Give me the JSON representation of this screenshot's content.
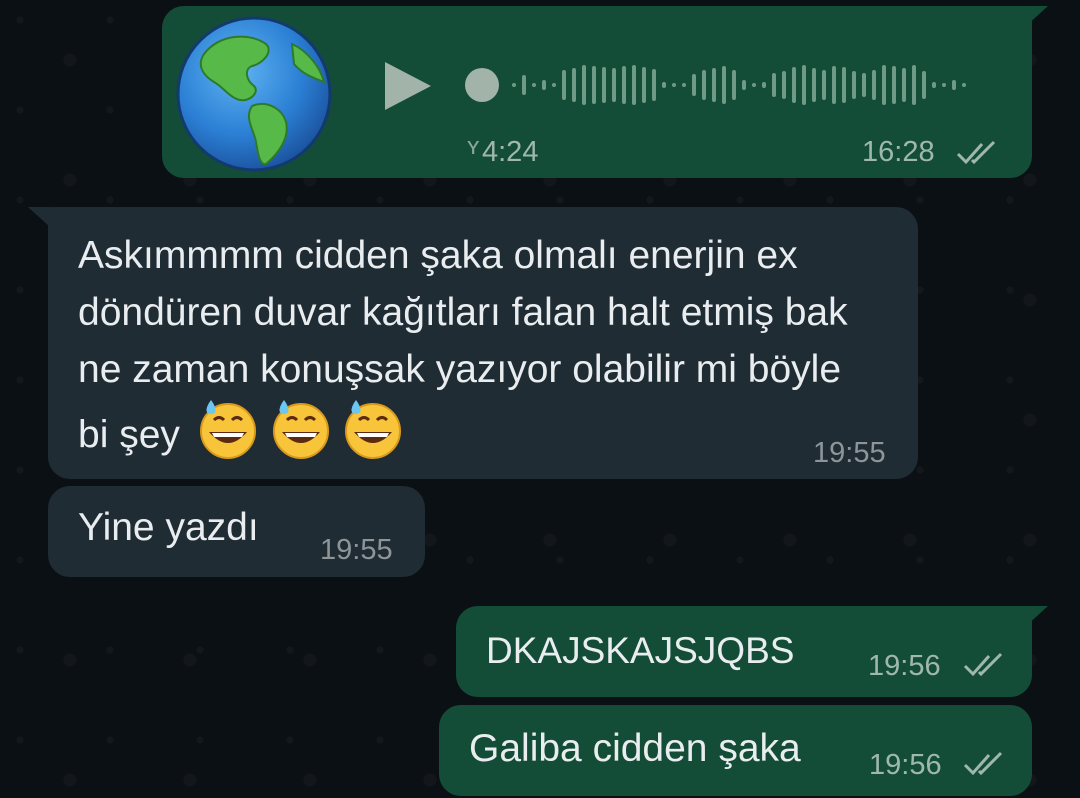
{
  "voice_message": {
    "duration": "4:24",
    "time": "16:28",
    "status": "read-double-check-icon",
    "avatar": "globe-americas-emoji"
  },
  "messages": [
    {
      "direction": "incoming",
      "text": "Askımmmm cidden şaka olmalı enerjin ex döndüren duvar kağıtları falan halt etmiş bak ne zaman konuşsak yazıyor olabilir mi böyle bi şey",
      "emojis": [
        "grinning-sweat-emoji",
        "grinning-sweat-emoji",
        "grinning-sweat-emoji"
      ],
      "time": "19:55"
    },
    {
      "direction": "incoming",
      "text": "Yine yazdı",
      "time": "19:55"
    },
    {
      "direction": "outgoing",
      "text": "DKAJSKAJSJQBS",
      "time": "19:56",
      "status": "read-double-check-icon"
    },
    {
      "direction": "outgoing",
      "text": "Galiba cidden şaka",
      "time": "19:56",
      "status": "read-double-check-icon"
    }
  ],
  "colors": {
    "background": "#0b1014",
    "outgoing_bubble": "#144d37",
    "incoming_bubble": "#1f2c33",
    "text": "#e9edef",
    "meta_outgoing": "#9fb8ab",
    "meta_incoming": "#8d9599"
  }
}
